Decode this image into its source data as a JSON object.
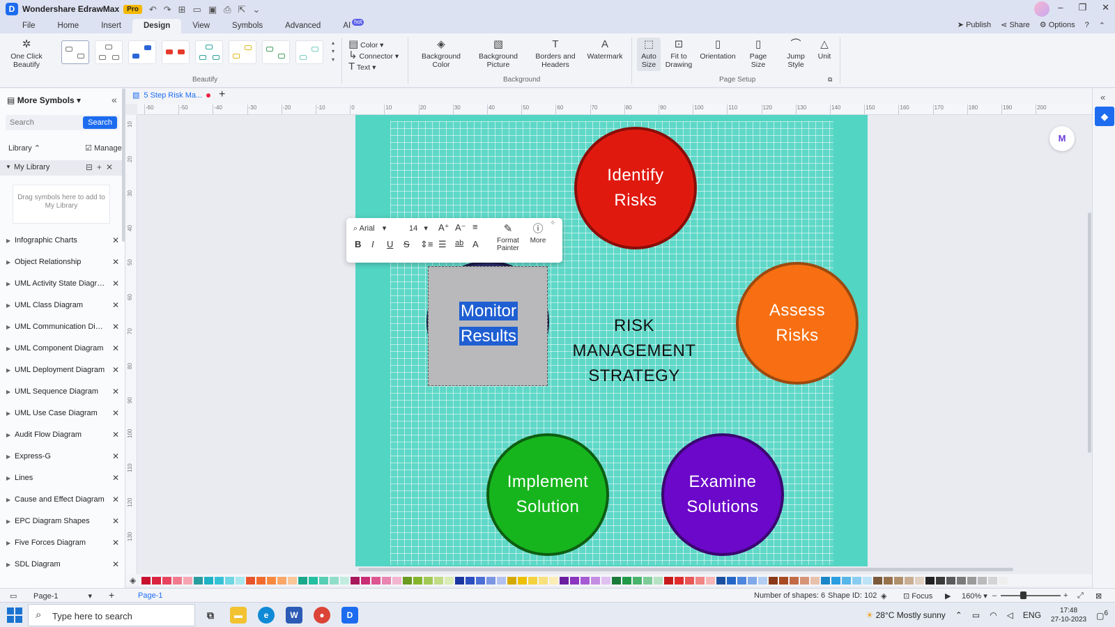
{
  "titlebar": {
    "app_name": "Wondershare EdrawMax",
    "badge": "Pro"
  },
  "menu": {
    "tabs": [
      "File",
      "Home",
      "Insert",
      "Design",
      "View",
      "Symbols",
      "Advanced",
      "AI"
    ],
    "active": "Design",
    "ai_badge": "hot",
    "right": {
      "publish": "Publish",
      "share": "Share",
      "options": "Options"
    }
  },
  "ribbon": {
    "one_click": "One Click Beautify",
    "beautify_label": "Beautify",
    "color": "Color",
    "connector": "Connector",
    "text": "Text",
    "bg_color": "Background Color",
    "bg_picture": "Background Picture",
    "borders": "Borders and Headers",
    "watermark": "Watermark",
    "background_label": "Background",
    "auto_size": "Auto Size",
    "fit_drawing": "Fit to Drawing",
    "orientation": "Orientation",
    "page_size": "Page Size",
    "jump_style": "Jump Style",
    "unit": "Unit",
    "page_setup_label": "Page Setup"
  },
  "leftpanel": {
    "title": "More Symbols",
    "search_placeholder": "Search",
    "search_button": "Search",
    "library": "Library",
    "manage": "Manage",
    "my_library": "My Library",
    "drop_hint": "Drag symbols here to add to My Library",
    "items": [
      "Infographic Charts",
      "Object Relationship",
      "UML Activity State Diagram",
      "UML Class Diagram",
      "UML Communication Diagr...",
      "UML Component Diagram",
      "UML Deployment Diagram",
      "UML Sequence Diagram",
      "UML Use Case Diagram",
      "Audit Flow Diagram",
      "Express-G",
      "Lines",
      "Cause and Effect Diagram",
      "EPC Diagram Shapes",
      "Five Forces Diagram",
      "SDL Diagram"
    ]
  },
  "doc": {
    "tab_name": "5 Step Risk Ma..."
  },
  "rulers": {
    "h": [
      "-60",
      "-50",
      "-40",
      "-30",
      "-20",
      "-10",
      "0",
      "10",
      "20",
      "30",
      "40",
      "50",
      "60",
      "70",
      "80",
      "90",
      "100",
      "110",
      "120",
      "130",
      "140",
      "150",
      "160",
      "170",
      "180",
      "190",
      "200"
    ],
    "v": [
      "10",
      "20",
      "30",
      "40",
      "50",
      "60",
      "70",
      "80",
      "90",
      "100",
      "110",
      "120",
      "130"
    ]
  },
  "diagram": {
    "c1": "Identify Risks",
    "c2": "Assess Risks",
    "c3": "Implement Solution",
    "c4": "Examine Solutions",
    "c5_line1": "Monitor",
    "c5_line2": "Results",
    "center_line1": "RISK",
    "center_line2": "MANAGEMENT",
    "center_line3": "STRATEGY",
    "colors": {
      "identify": "#e0190f",
      "assess": "#f76f12",
      "implement": "#17b51d",
      "examine": "#6b08c9",
      "page": "#53d5c3"
    }
  },
  "floating_toolbar": {
    "font": "Arial",
    "size": "14",
    "format_painter": "Format Painter",
    "more": "More"
  },
  "palette": [
    "#c8102e",
    "#d9233f",
    "#e8435e",
    "#f07a8c",
    "#f6a6b2",
    "#2a9d9f",
    "#1fb1c4",
    "#36c2d6",
    "#6fd6e3",
    "#a9e8ef",
    "#e8542a",
    "#f26b2e",
    "#f7893f",
    "#f9a766",
    "#fbc698",
    "#1aa88c",
    "#22bfa0",
    "#58cfb4",
    "#8fdec9",
    "#c3ecdf",
    "#a8195c",
    "#c92d74",
    "#dc5690",
    "#e985b1",
    "#f3b6d0",
    "#6a9a1f",
    "#84b52d",
    "#a2c955",
    "#c0dc85",
    "#dbecb5",
    "#1a36a0",
    "#2b4fc0",
    "#4c6fd6",
    "#7d96e3",
    "#b2c1f0",
    "#d4a800",
    "#ecc000",
    "#f4d23e",
    "#f8e07c",
    "#fbedb6",
    "#6a1fa0",
    "#8a34c0",
    "#a65bd4",
    "#c38de3",
    "#dfc0f1",
    "#1a7a3a",
    "#229a4a",
    "#48b46b",
    "#7dcc97",
    "#b5e3c3",
    "#c81a1a",
    "#e02c2c",
    "#e85656",
    "#f08686",
    "#f6b6b6",
    "#1a4fa0",
    "#2466c8",
    "#4d86dc",
    "#7fa9e8",
    "#b4cef3",
    "#8a3a1a",
    "#a84a22",
    "#c26a45",
    "#d69477",
    "#e8c1ad",
    "#1a86c8",
    "#2a9ee0",
    "#55b6e8",
    "#88cdf0",
    "#bde3f7",
    "#7a5a3a",
    "#96714c",
    "#b08f6d",
    "#c9ae93",
    "#e0d0bf",
    "#222222",
    "#3a3a3a",
    "#5a5a5a",
    "#7a7a7a",
    "#9a9a9a",
    "#bababa",
    "#d4d4d4",
    "#eeeeee"
  ],
  "statusbar": {
    "page_selector": "Page-1",
    "page_tab": "Page-1",
    "shapes": "Number of shapes: 6",
    "shape_id": "Shape ID: 102",
    "focus": "Focus",
    "zoom": "160%"
  },
  "taskbar": {
    "search_placeholder": "Type here to search",
    "weather": "28°C  Mostly sunny",
    "lang": "ENG",
    "time": "17:48",
    "date": "27-10-2023",
    "notifications": "6"
  }
}
